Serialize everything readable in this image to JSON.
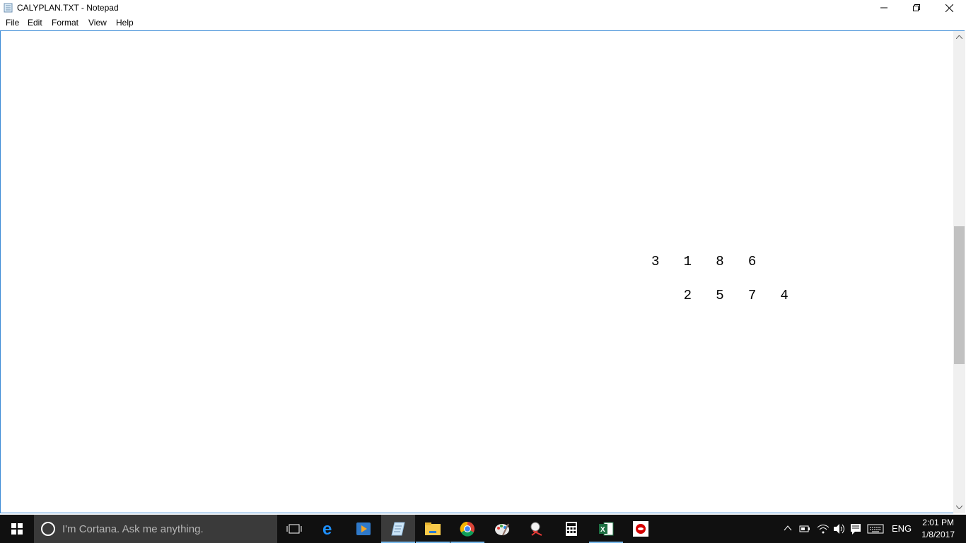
{
  "window": {
    "title": "CALYPLAN.TXT - Notepad"
  },
  "menu": {
    "items": [
      "File",
      "Edit",
      "Format",
      "View",
      "Help"
    ]
  },
  "editor": {
    "line1": "3   1   8   6",
    "line2": "    2   5   7   4"
  },
  "taskbar": {
    "cortana_placeholder": "I'm Cortana. Ask me anything.",
    "pinned_icons": [
      "task-view-icon",
      "edge-icon",
      "media-player-icon",
      "notepad-icon",
      "file-explorer-icon",
      "chrome-icon",
      "paint-icon",
      "snipping-tool-icon",
      "calculator-icon",
      "excel-icon",
      "red-app-icon"
    ],
    "language": "ENG",
    "time": "2:01 PM",
    "date": "1/8/2017"
  },
  "colors": {
    "taskbar_bg": "#101010",
    "cortana_bg": "#3a3a3a",
    "accent": "#76b9ed",
    "editor_border": "#3c8bd6"
  }
}
